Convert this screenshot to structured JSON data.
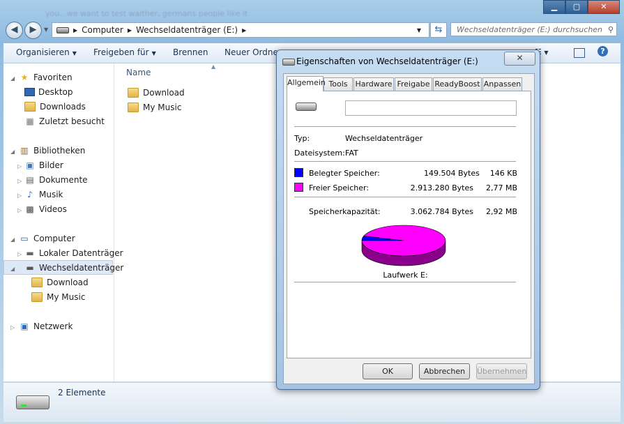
{
  "window": {
    "title_blurred": "you...we want to test walther, germans people like it",
    "controls": {
      "minimize": "▁",
      "maximize": "▢",
      "close": "✕"
    }
  },
  "address": {
    "parts": [
      "Computer",
      "Wechseldatenträger (E:)"
    ]
  },
  "search": {
    "placeholder": "Wechseldatenträger (E:) durchsuchen"
  },
  "toolbar": {
    "organize": "Organisieren",
    "share": "Freigeben für",
    "burn": "Brennen",
    "new_folder": "Neuer Ordner"
  },
  "nav": {
    "favorites": "Favoriten",
    "desktop": "Desktop",
    "downloads": "Downloads",
    "recent": "Zuletzt besucht",
    "libraries": "Bibliotheken",
    "pictures": "Bilder",
    "documents": "Dokumente",
    "music": "Musik",
    "videos": "Videos",
    "computer": "Computer",
    "local_disk": "Lokaler Datenträger",
    "removable": "Wechseldatenträger",
    "sub_download": "Download",
    "sub_mymusic": "My Music",
    "network": "Netzwerk"
  },
  "content": {
    "column_name": "Name",
    "files": [
      "Download",
      "My Music"
    ]
  },
  "details": {
    "count": "2 Elemente"
  },
  "dialog": {
    "title": "Eigenschaften von Wechseldatenträger (E:)",
    "tabs": [
      "Allgemein",
      "Tools",
      "Hardware",
      "Freigabe",
      "ReadyBoost",
      "Anpassen"
    ],
    "type_label": "Typ:",
    "type_value": "Wechseldatenträger",
    "fs_label": "Dateisystem:",
    "fs_value": "FAT",
    "used_label": "Belegter Speicher:",
    "used_bytes": "149.504 Bytes",
    "used_short": "146 KB",
    "free_label": "Freier Speicher:",
    "free_bytes": "2.913.280 Bytes",
    "free_short": "2,77 MB",
    "cap_label": "Speicherkapazität:",
    "cap_bytes": "3.062.784 Bytes",
    "cap_short": "2,92 MB",
    "drive_label": "Laufwerk E:",
    "buttons": {
      "ok": "OK",
      "cancel": "Abbrechen",
      "apply": "Übernehmen"
    },
    "colors": {
      "used": "#0000ff",
      "free": "#ff00ff"
    },
    "pie": {
      "used": 149504,
      "free": 2913280
    }
  }
}
